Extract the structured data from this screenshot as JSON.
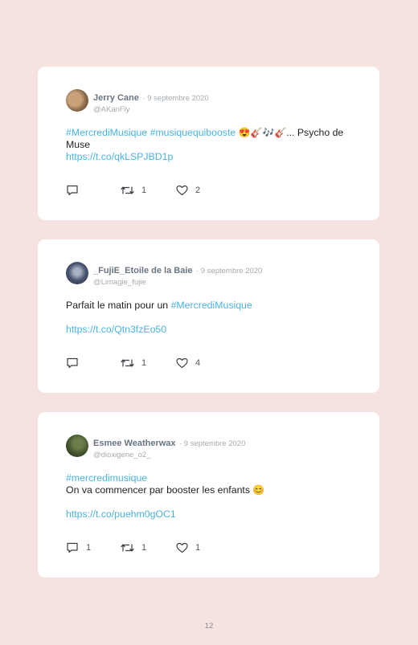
{
  "tweets": [
    {
      "name": "Jerry Cane",
      "date": "· 9 septembre 2020",
      "handle": "@AKanFly",
      "text_parts": [
        "#MercrediMusique #musiquequibooste",
        "😍🎸🎶🎸...",
        " Psycho de Muse"
      ],
      "link": "https://t.co/qkLSPJBD1p",
      "replies": "",
      "retweets": "1",
      "likes": "2"
    },
    {
      "name": "_FujiE_Etoile de la Baie",
      "date": "· 9 septembre 2020",
      "handle": "@Limagie_fujie",
      "text_parts": [
        "Parfait le matin pour un ",
        "#MercrediMusique"
      ],
      "link": "https://t.co/Qtn3fzEo50",
      "replies": "",
      "retweets": "1",
      "likes": "4"
    },
    {
      "name": "Esmee Weatherwax",
      "date": "· 9 septembre 2020",
      "handle": "@dioxigene_o2_",
      "text_parts": [
        "#mercredimusique",
        "On va commencer par booster les enfants ",
        "😊"
      ],
      "link": "https://t.co/puehm0gOC1",
      "replies": "1",
      "retweets": "1",
      "likes": "1"
    }
  ],
  "icons": [
    "reply-icon",
    "retweet-icon",
    "like-icon"
  ],
  "page_number": "12"
}
